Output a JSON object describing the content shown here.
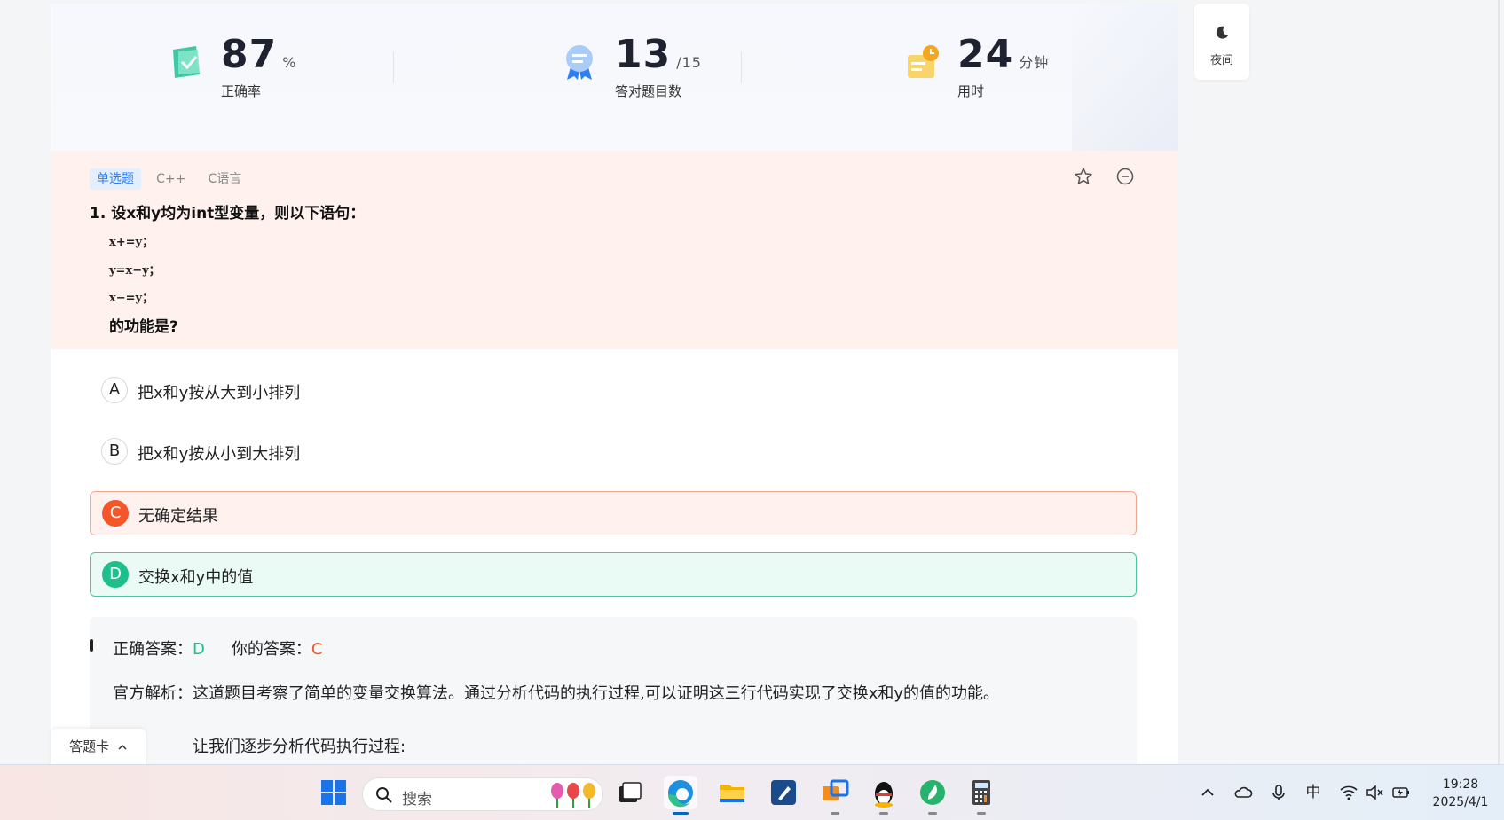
{
  "stats": {
    "accuracy": {
      "value": "87",
      "unit": "%",
      "label": "正确率"
    },
    "correct_count": {
      "value": "13",
      "unit": "/15",
      "label": "答对题目数"
    },
    "time_used": {
      "value": "24",
      "unit": "分钟",
      "label": "用时"
    }
  },
  "side": {
    "night_label": "夜间"
  },
  "question": {
    "tags": [
      "单选题",
      "C++",
      "C语言"
    ],
    "title": "1. 设x和y均为int型变量，则以下语句：",
    "code_lines": [
      "x+=y；",
      "y=x−y；",
      "x−=y；"
    ],
    "tail": "的功能是?"
  },
  "options": [
    {
      "letter": "A",
      "text": "把x和y按从大到小排列",
      "state": "normal"
    },
    {
      "letter": "B",
      "text": "把x和y按从小到大排列",
      "state": "normal"
    },
    {
      "letter": "C",
      "text": "无确定结果",
      "state": "wrong"
    },
    {
      "letter": "D",
      "text": "交换x和y中的值",
      "state": "right"
    }
  ],
  "analysis": {
    "correct_label": "正确答案：",
    "correct_value": "D",
    "yours_label": "你的答案：",
    "yours_value": "C",
    "explanation": "官方解析：这道题目考察了简单的变量交换算法。通过分析代码的执行过程,可以证明这三行代码实现了交换x和y的值的功能。",
    "step_intro": "让我们逐步分析代码执行过程:"
  },
  "answer_card": {
    "label": "答题卡"
  },
  "taskbar": {
    "search_placeholder": "搜索",
    "ime": "中",
    "time": "19:28",
    "date": "2025/4/1"
  },
  "colors": {
    "correct": "#1fbf8c",
    "wrong": "#f45629",
    "tag_blue": "#2f7df5"
  }
}
